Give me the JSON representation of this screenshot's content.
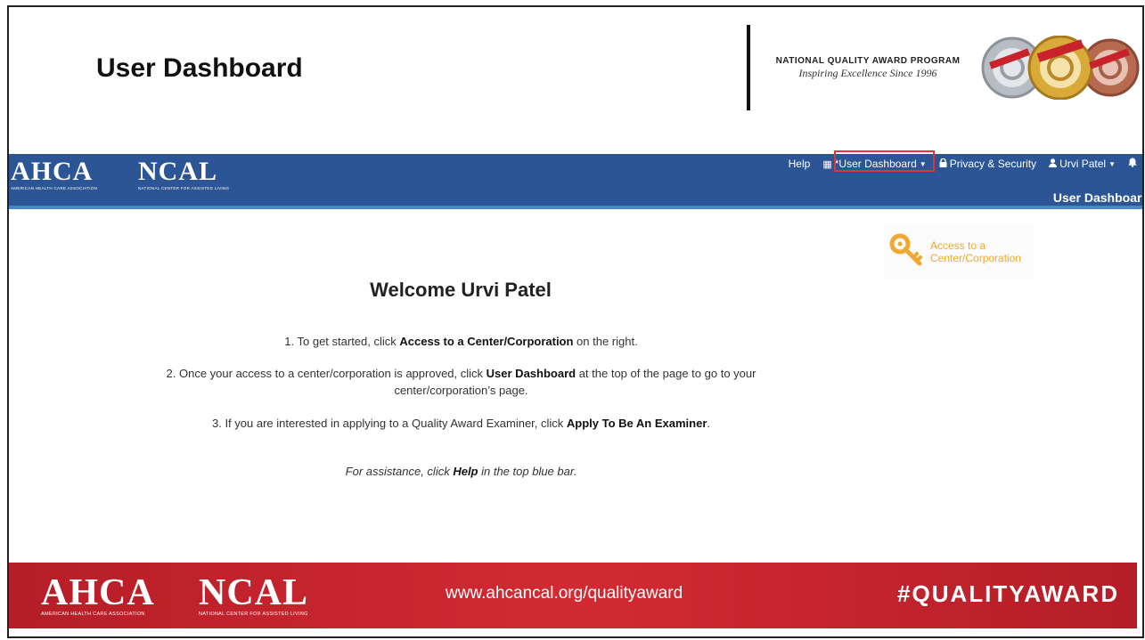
{
  "slide": {
    "title": "User Dashboard",
    "program": {
      "title": "NATIONAL QUALITY AWARD PROGRAM",
      "tagline": "Inspiring Excellence Since 1996"
    }
  },
  "site": {
    "logos": {
      "ahca": "AHCA",
      "ahca_sub": "AMERICAN HEALTH CARE ASSOCIATION",
      "ncal": "NCAL",
      "ncal_sub": "NATIONAL CENTER FOR ASSISTED LIVING"
    },
    "nav": {
      "help": "Help",
      "user_dashboard": "*User Dashboard",
      "privacy": "Privacy & Security",
      "user": "Urvi Patel"
    },
    "page_label": "User Dashboard",
    "access_card": {
      "line1": "Access to a",
      "line2": "Center/Corporation"
    },
    "welcome": "Welcome Urvi Patel",
    "steps": {
      "s1_pre": "1. To get started, click ",
      "s1_bold": "Access to a Center/Corporation",
      "s1_post": " on the right.",
      "s2_pre": "2. Once your access to a center/corporation is approved, click ",
      "s2_bold": "User Dashboard",
      "s2_post": " at the top of the page to go to your center/corporation’s page.",
      "s3_pre": "3. If you are interested in applying to a Quality Award Examiner, click ",
      "s3_bold": "Apply To Be An Examiner",
      "s3_post": "."
    },
    "assist": {
      "pre": "For assistance, click ",
      "bold": "Help",
      "post": " in the top blue bar."
    }
  },
  "banner": {
    "ahca": "AHCA",
    "ahca_sub": "AMERICAN HEALTH CARE ASSOCIATION",
    "ncal": "NCAL",
    "ncal_sub": "NATIONAL CENTER FOR ASSISTED LIVING",
    "url": "www.ahcancal.org/qualityaward",
    "hashtag": "#QUALITYAWARD"
  },
  "colors": {
    "nav_blue": "#2b5594",
    "nav_accent": "#4a86c8",
    "key_gold": "#f0a830",
    "banner_red": "#c8232c",
    "highlight_red": "#d9363e"
  },
  "icons": {
    "user_dashboard": "building-icon",
    "privacy": "lock-icon",
    "user": "user-icon",
    "notifications": "bell-icon",
    "access": "key-icon"
  }
}
